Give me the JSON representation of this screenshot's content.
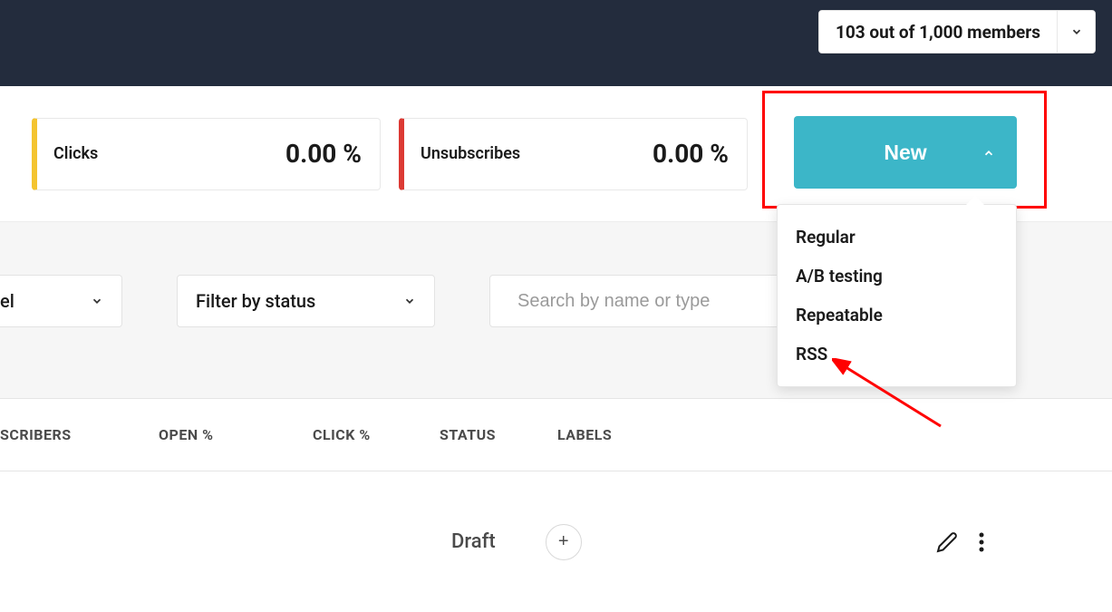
{
  "header": {
    "members_text": "103 out of 1,000 members"
  },
  "stats": {
    "clicks": {
      "label": "Clicks",
      "value": "0.00 %"
    },
    "unsubscribes": {
      "label": "Unsubscribes",
      "value": "0.00 %"
    }
  },
  "new_button": {
    "label": "New",
    "menu": {
      "regular": "Regular",
      "ab_testing": "A/B testing",
      "repeatable": "Repeatable",
      "rss": "RSS"
    }
  },
  "filters": {
    "label_partial": "el",
    "status": "Filter by status",
    "search_placeholder": "Search by name or type"
  },
  "columns": {
    "subscribers": "SCRIBERS",
    "open": "OPEN %",
    "click": "CLICK %",
    "status": "STATUS",
    "labels": "LABELS"
  },
  "row": {
    "status": "Draft",
    "plus": "+"
  }
}
